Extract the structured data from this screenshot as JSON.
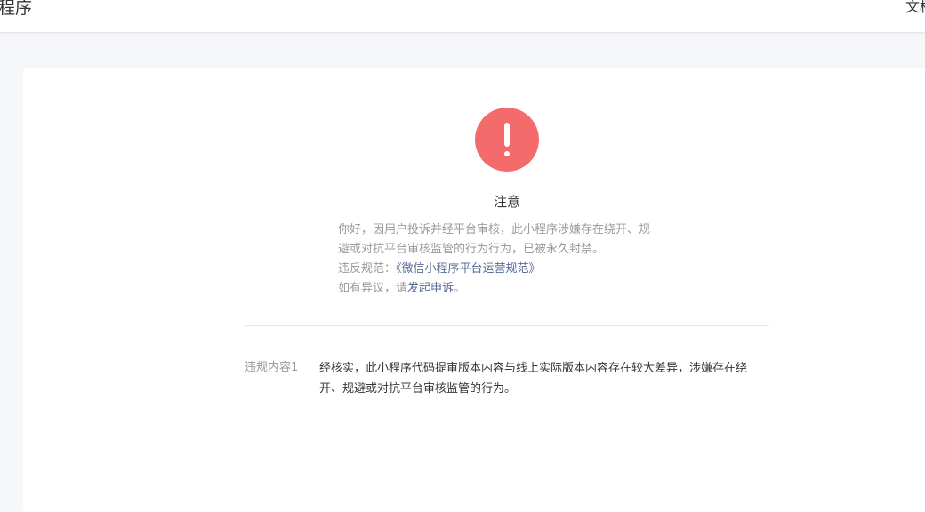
{
  "header": {
    "brand": "程序",
    "doc_link": "文档"
  },
  "notice": {
    "icon": "exclamation-icon",
    "icon_color": "#f46b6b",
    "title": "注意",
    "line1": "你好，因用户投诉并经平台审核，此小程序涉嫌存在绕开、规",
    "line2": "避或对抗平台审核监管的行为行为，已被永久封禁。",
    "violation_prefix": "违反规范：",
    "violation_link": "《微信小程序平台运营规范》",
    "appeal_prefix": "如有异议，请",
    "appeal_link": "发起申诉",
    "appeal_suffix": "。"
  },
  "violations": [
    {
      "label": "违规内容1",
      "content": "经核实，此小程序代码提审版本内容与线上实际版本内容存在较大差异，涉嫌存在绕开、规避或对抗平台审核监管的行为。"
    }
  ],
  "colors": {
    "link": "#576b95",
    "muted": "#9a9a9a",
    "text": "#353535"
  }
}
